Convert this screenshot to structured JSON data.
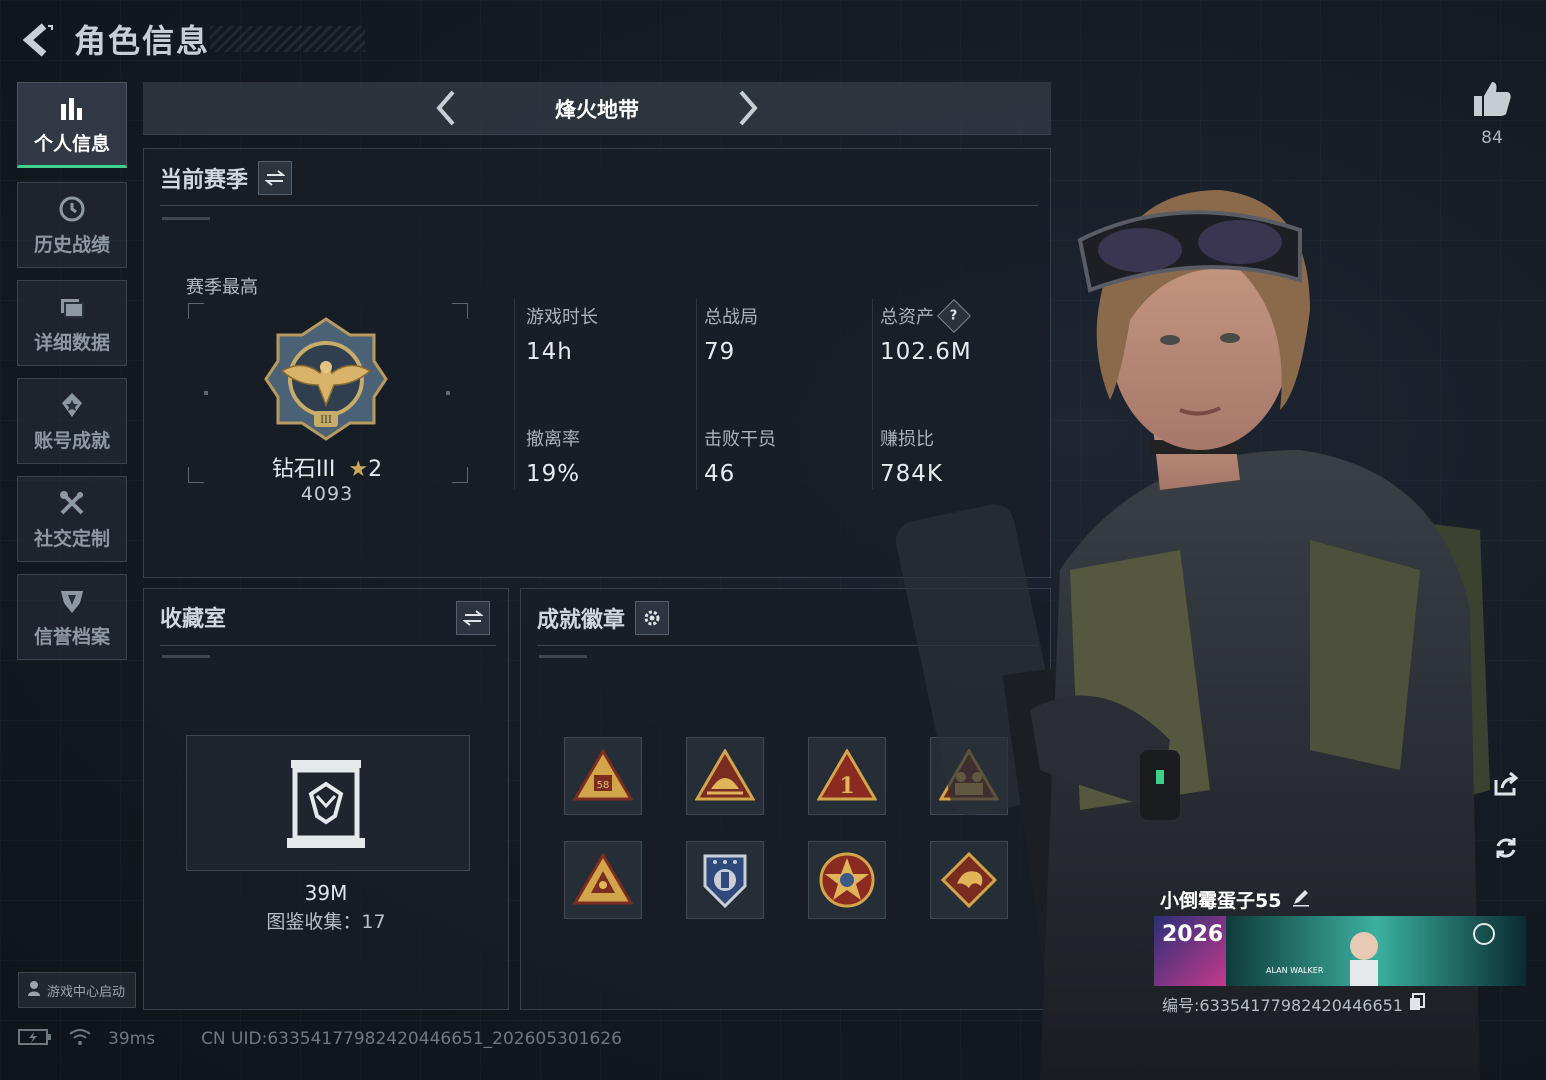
{
  "header": {
    "title": "角色信息"
  },
  "sidebar": {
    "items": [
      {
        "label": "个人信息",
        "icon": "bar-chart-icon",
        "active": true
      },
      {
        "label": "历史战绩",
        "icon": "clock-icon",
        "active": false
      },
      {
        "label": "详细数据",
        "icon": "folder-icon",
        "active": false
      },
      {
        "label": "账号成就",
        "icon": "achievement-icon",
        "active": false
      },
      {
        "label": "社交定制",
        "icon": "tools-icon",
        "active": false
      },
      {
        "label": "信誉档案",
        "icon": "shield-icon",
        "active": false
      }
    ],
    "launch_label": "游戏中心启动"
  },
  "mode": {
    "title": "烽火地带"
  },
  "season": {
    "title": "当前赛季",
    "best_label": "赛季最高",
    "rank_name": "钻石III",
    "rank_stars": "2",
    "rank_points": "4093",
    "stats": [
      {
        "label": "游戏时长",
        "value": "14h"
      },
      {
        "label": "总战局",
        "value": "79"
      },
      {
        "label": "总资产",
        "value": "102.6M",
        "help": "?"
      },
      {
        "label": "撤离率",
        "value": "19%"
      },
      {
        "label": "击败干员",
        "value": "46"
      },
      {
        "label": "赚损比",
        "value": "784K"
      }
    ]
  },
  "collection": {
    "title": "收藏室",
    "value": "39M",
    "count_text": "图鉴收集：17"
  },
  "achievements": {
    "title": "成就徽章",
    "badges": [
      "badge-58-icon",
      "badge-helmet-icon",
      "badge-number-one-icon",
      "badge-squad-icon",
      "badge-triangle-icon",
      "badge-shield-icon",
      "badge-star-icon",
      "badge-dragon-icon"
    ]
  },
  "profile": {
    "likes": "84",
    "nickname": "小倒霉蛋子55",
    "id_text": "编号:6335417798242044665​1",
    "banner_year": "2026",
    "banner_tag": "ALAN WALKER"
  },
  "status": {
    "latency": "39ms",
    "uid": "CN UID:63354177982420446651_202605301626"
  },
  "colors": {
    "accent": "#3fd18b",
    "background": "#141a22",
    "panel_border": "#37404b"
  }
}
